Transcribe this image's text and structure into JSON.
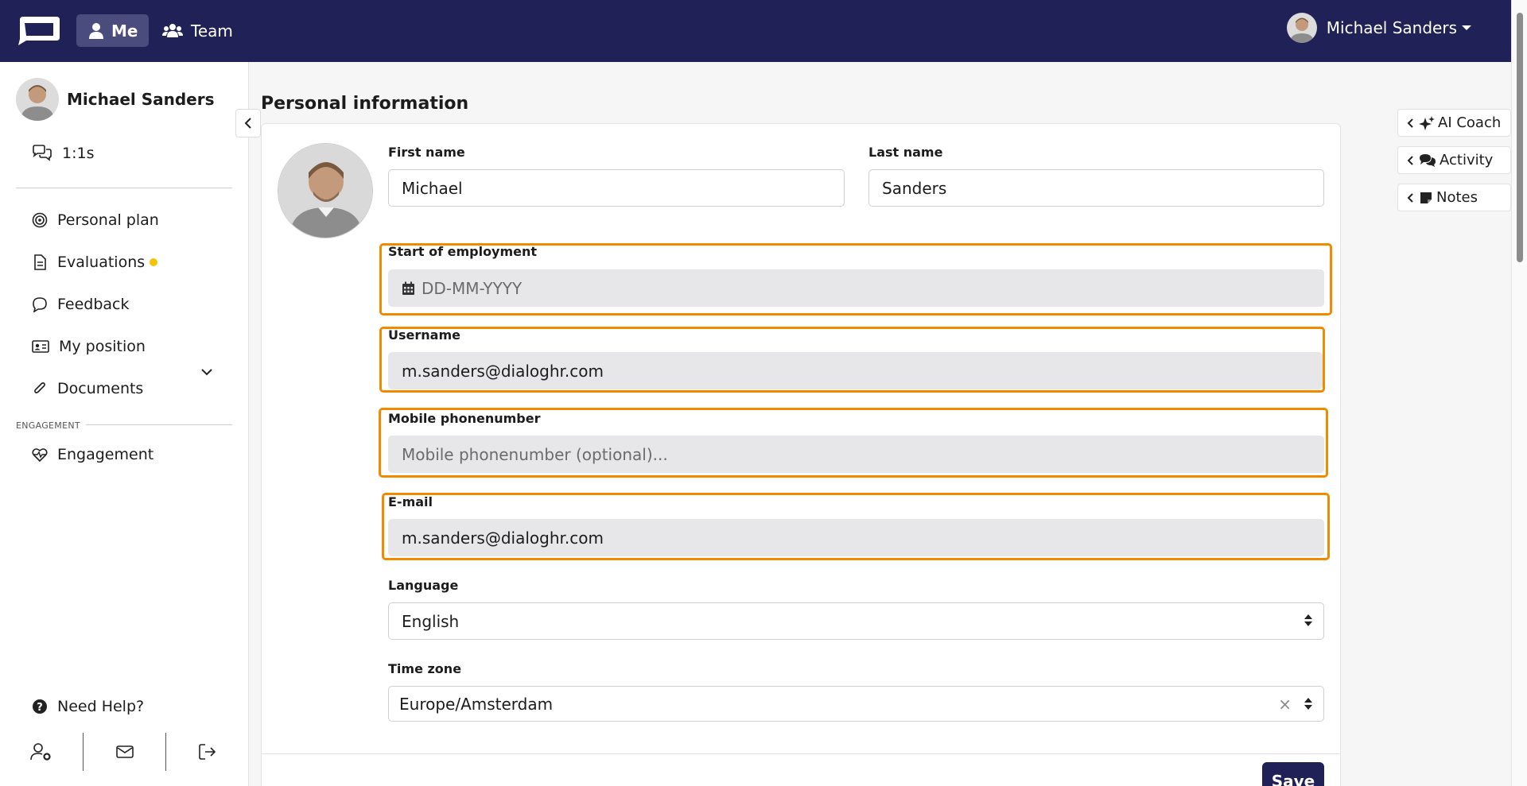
{
  "topbar": {
    "nav": [
      {
        "label": "Me",
        "icon": "user-icon"
      },
      {
        "label": "Team",
        "icon": "users-icon"
      }
    ],
    "user_name": "Michael Sanders"
  },
  "sidebar": {
    "profile_name": "Michael Sanders",
    "items": [
      {
        "label": "1:1s",
        "icon": "chat-bubbles-icon"
      },
      {
        "label": "Personal plan",
        "icon": "target-icon"
      },
      {
        "label": "Evaluations",
        "icon": "document-icon"
      },
      {
        "label": "Feedback",
        "icon": "speech-bubble-icon"
      },
      {
        "label": "My position",
        "icon": "id-card-icon"
      },
      {
        "label": "Documents",
        "icon": "paperclip-icon"
      },
      {
        "label": "Engagement",
        "icon": "heart-pulse-icon"
      }
    ],
    "section_label": "ENGAGEMENT",
    "help_label": "Need Help?",
    "evaluations_badge_color": "#f5c400"
  },
  "main": {
    "title": "Personal information",
    "first_name_label": "First name",
    "first_name_value": "Michael",
    "last_name_label": "Last name",
    "last_name_value": "Sanders",
    "start_label": "Start of employment",
    "start_placeholder": "DD-MM-YYYY",
    "username_label": "Username",
    "username_value": "m.sanders@dialoghr.com",
    "mobile_label": "Mobile phonenumber",
    "mobile_placeholder": "Mobile phonenumber (optional)...",
    "email_label": "E-mail",
    "email_value": "m.sanders@dialoghr.com",
    "language_label": "Language",
    "language_value": "English",
    "timezone_label": "Time zone",
    "timezone_value": "Europe/Amsterdam",
    "save_label": "Save"
  },
  "right_tabs": [
    {
      "label": "AI Coach",
      "icon": "sparkles-icon"
    },
    {
      "label": "Activity",
      "icon": "comments-icon"
    },
    {
      "label": "Notes",
      "icon": "note-icon"
    }
  ],
  "colors": {
    "brand": "#1f2157",
    "highlight": "#f28a00"
  }
}
